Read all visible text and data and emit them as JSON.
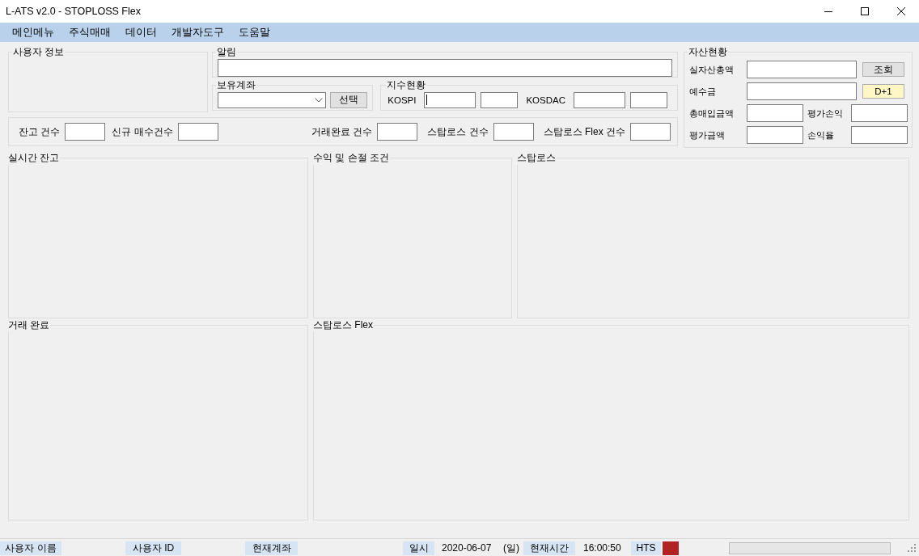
{
  "window": {
    "title": "L-ATS v2.0 - STOPLOSS Flex"
  },
  "menu": [
    {
      "label": "메인메뉴"
    },
    {
      "label": "주식매매"
    },
    {
      "label": "데이터"
    },
    {
      "label": "개발자도구"
    },
    {
      "label": "도움말"
    }
  ],
  "user_info": {
    "title": "사용자 정보"
  },
  "notice": {
    "title": "알림"
  },
  "account": {
    "title": "보유계좌",
    "button": "선택"
  },
  "index": {
    "title": "지수현황",
    "fields": [
      {
        "label": "KOSPI",
        "focused": true
      },
      {
        "label": "KOSDAC",
        "focused": false
      }
    ]
  },
  "counts": {
    "left": [
      {
        "label": "잔고 건수"
      },
      {
        "label": "신규 매수건수"
      }
    ],
    "right": [
      {
        "label": "거래완료 건수"
      },
      {
        "label": "스탑로스 건수"
      },
      {
        "label": "스탑로스 Flex 건수"
      }
    ]
  },
  "assets": {
    "title": "자산현황",
    "rows": [
      {
        "kind": "button",
        "label": "실자산총액",
        "button": {
          "label": "조회",
          "highlighted": false
        }
      },
      {
        "kind": "button",
        "label": "예수금",
        "button": {
          "label": "D+1",
          "highlighted": true
        }
      },
      {
        "kind": "pair",
        "label": "총매입금액",
        "label_2": "평가손익"
      },
      {
        "kind": "pair",
        "label": "평가금액",
        "label_2": "손익율"
      }
    ]
  },
  "panels": [
    {
      "title": "실시간 잔고"
    },
    {
      "title": "수익 및 손절 조건"
    },
    {
      "title": "스탑로스"
    },
    {
      "title": "거래 완료"
    },
    {
      "title": "스탑로스 Flex"
    }
  ],
  "status_bar": [
    {
      "kind": "label",
      "text": "사용자 이름"
    },
    {
      "kind": "label",
      "text": "사용자 ID"
    },
    {
      "kind": "label",
      "text": "현재계좌"
    },
    {
      "kind": "label",
      "text": "일시"
    },
    {
      "kind": "value",
      "text": "2020-06-07"
    },
    {
      "kind": "value",
      "text": "(일)"
    },
    {
      "kind": "label",
      "text": "현재시간"
    },
    {
      "kind": "value",
      "text": "16:00:50"
    },
    {
      "kind": "label",
      "text": "HTS"
    },
    {
      "kind": "indicator",
      "color": "#b22222"
    },
    {
      "kind": "progress",
      "level": 0
    }
  ]
}
